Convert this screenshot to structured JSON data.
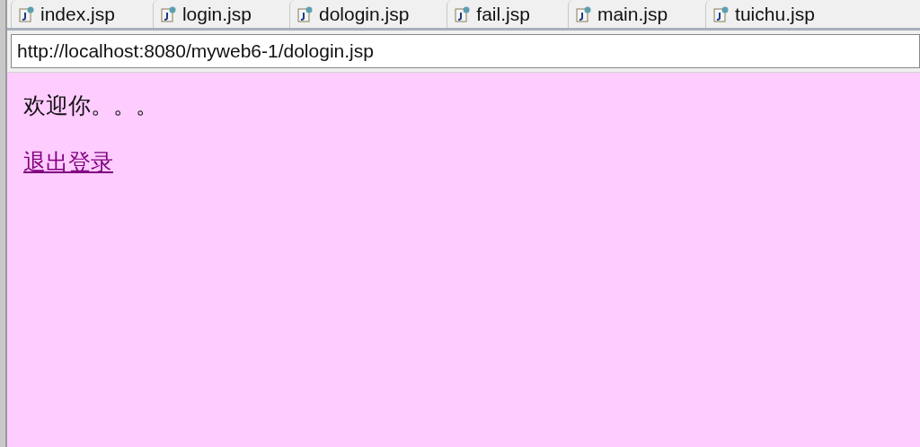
{
  "tabs": [
    {
      "label": "index.jsp",
      "selected": false
    },
    {
      "label": "login.jsp",
      "selected": false
    },
    {
      "label": "dologin.jsp",
      "selected": false
    },
    {
      "label": "fail.jsp",
      "selected": false
    },
    {
      "label": "main.jsp",
      "selected": false
    },
    {
      "label": "tuichu.jsp",
      "selected": false
    }
  ],
  "address": {
    "value": "http://localhost:8080/myweb6-1/dologin.jsp"
  },
  "page": {
    "greeting": "欢迎你。。。",
    "link": "退出登录"
  }
}
